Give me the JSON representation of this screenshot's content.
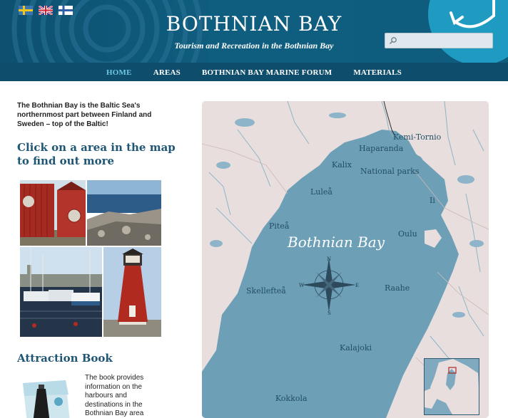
{
  "header": {
    "title": "BOTHNIAN BAY",
    "tagline": "Tourism and Recreation in the Bothnian Bay",
    "search": {
      "placeholder": "",
      "value": ""
    },
    "flags": [
      "swedish-flag",
      "uk-flag",
      "finnish-flag"
    ]
  },
  "nav": {
    "items": [
      {
        "label": "HOME",
        "active": true
      },
      {
        "label": "AREAS",
        "active": false
      },
      {
        "label": "BOTHNIAN BAY MARINE FORUM",
        "active": false
      },
      {
        "label": "MATERIALS",
        "active": false
      }
    ]
  },
  "intro": {
    "text": "The Bothnian Bay is the Baltic Sea's northernmost part between Finland and Sweden – top of the Baltic!",
    "cta": "Click on a area in the map to find out more"
  },
  "attraction_book": {
    "heading": "Attraction Book",
    "text": "The book provides information on the harbours and destinations in the Bothnian Bay area and"
  },
  "map": {
    "title": "Bothnian Bay",
    "places": {
      "kemi_tornio": "Kemi-Tornio",
      "haparanda": "Haparanda",
      "kalix": "Kalix",
      "national_parks": "National parks",
      "lulea": "Luleå",
      "ii": "Ii",
      "pitea": "Piteå",
      "oulu": "Oulu",
      "skelleftea": "Skellefteå",
      "raahe": "Raahe",
      "kalajoki": "Kalajoki",
      "kokkola": "Kokkola"
    },
    "compass": {
      "n": "N",
      "s": "S",
      "e": "E",
      "w": "W"
    }
  },
  "colors": {
    "header_bg": "#0f5e80",
    "nav_bg": "#0e4d6b",
    "nav_active": "#6fc7e6",
    "heading_blue": "#1f5675",
    "sea": "#6d9fb7",
    "land": "#e8dede"
  }
}
